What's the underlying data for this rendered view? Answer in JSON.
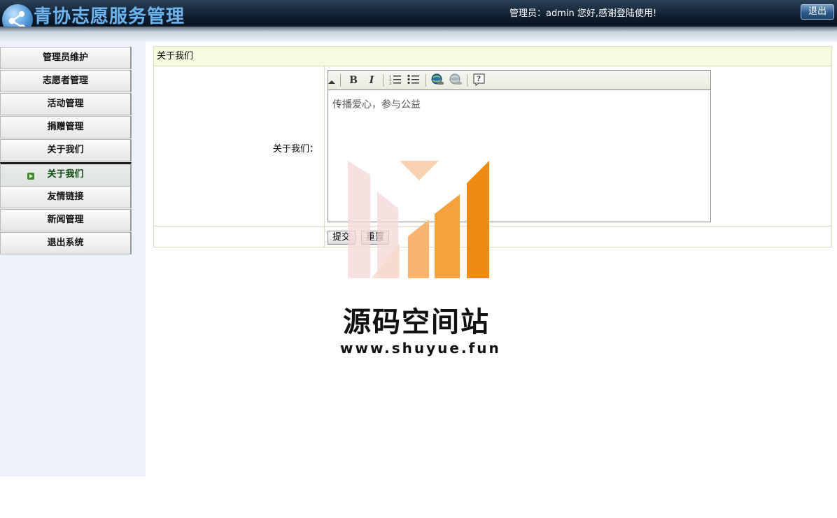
{
  "app": {
    "title": "青协志愿服务管理",
    "admin_info": "管理员：admin 您好,感谢登陆使用!",
    "logout_label": "退出"
  },
  "sidebar": {
    "items": [
      {
        "label": "管理员维护",
        "active": false
      },
      {
        "label": "志愿者管理",
        "active": false
      },
      {
        "label": "活动管理",
        "active": false
      },
      {
        "label": "捐赠管理",
        "active": false
      },
      {
        "label": "关于我们",
        "active": false
      },
      {
        "label": "关于我们",
        "active": true
      },
      {
        "label": "友情链接",
        "active": false
      },
      {
        "label": "新闻管理",
        "active": false
      },
      {
        "label": "退出系统",
        "active": false
      }
    ]
  },
  "main": {
    "panel_title": "关于我们",
    "field_label": "关于我们：",
    "editor": {
      "content": "传播爱心，参与公益",
      "toolbar": [
        "bold-icon",
        "italic-icon",
        "ordered-list-icon",
        "unordered-list-icon",
        "link-icon",
        "unlink-icon",
        "help-icon"
      ]
    },
    "submit_label": "提交",
    "reset_label": "重置"
  },
  "watermark": {
    "text": "源码空间站",
    "url": "www.shuyue.fun"
  }
}
